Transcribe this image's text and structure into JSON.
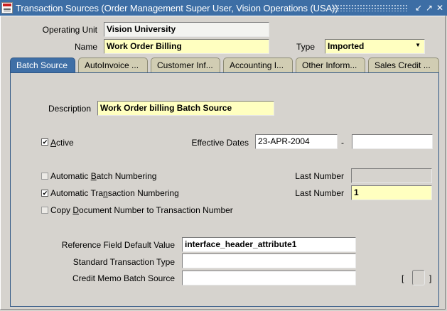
{
  "window": {
    "title": "Transaction Sources (Order Management Super User, Vision Operations (USA))",
    "minimize_glyph": "↙",
    "maximize_glyph": "↗",
    "close_glyph": "✕"
  },
  "header": {
    "operating_unit_label": "Operating Unit",
    "operating_unit_value": "Vision University",
    "name_label": "Name",
    "name_value": "Work Order Billing",
    "type_label": "Type",
    "type_value": "Imported"
  },
  "tabs": [
    {
      "label": "Batch Source",
      "active": true
    },
    {
      "label": "AutoInvoice ..."
    },
    {
      "label": "Customer Inf..."
    },
    {
      "label": "Accounting I..."
    },
    {
      "label": "Other Inform..."
    },
    {
      "label": "Sales Credit ..."
    }
  ],
  "batch_source": {
    "description_label": "Description",
    "description_value": "Work Order billing Batch Source",
    "active": {
      "pre": "",
      "mnemonic": "A",
      "post": "ctive",
      "checked": true
    },
    "effective_dates_label": "Effective Dates",
    "effective_from": "23-APR-2004",
    "date_separator": "-",
    "effective_to": "",
    "auto_batch_numbering": {
      "pre": "Automatic ",
      "mnemonic": "B",
      "post": "atch Numbering",
      "checked": false,
      "enabled": false
    },
    "auto_batch_last_number_label": "Last Number",
    "auto_batch_last_number_value": "",
    "auto_transaction_numbering": {
      "pre": "Automatic Tra",
      "mnemonic": "n",
      "post": "saction Numbering",
      "checked": true,
      "enabled": true
    },
    "auto_trx_last_number_label": "Last Number",
    "auto_trx_last_number_value": "1",
    "copy_document_number": {
      "pre": "Copy ",
      "mnemonic": "D",
      "post": "ocument Number to Transaction Number",
      "checked": false,
      "enabled": false
    },
    "reference_field_label": "Reference Field Default Value",
    "reference_field_value": "interface_header_attribute1",
    "standard_trx_type_label": "Standard Transaction Type",
    "standard_trx_type_value": "",
    "credit_memo_label": "Credit Memo Batch Source",
    "credit_memo_value": "",
    "dff_open": "[",
    "dff_close": "]"
  }
}
